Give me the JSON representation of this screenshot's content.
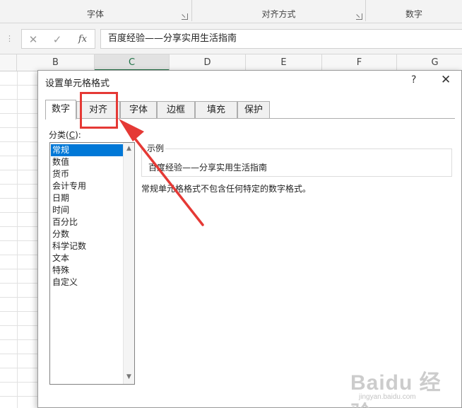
{
  "ribbon": {
    "groups": [
      {
        "label": "字体"
      },
      {
        "label": "对齐方式"
      },
      {
        "label": "数字"
      }
    ]
  },
  "formula_bar": {
    "grip": "⋮",
    "cancel": "✕",
    "enter": "✓",
    "fx": "fx",
    "content": "百度经验——分享实用生活指南"
  },
  "columns": [
    "B",
    "C",
    "D",
    "E",
    "F",
    "G"
  ],
  "active_column": "C",
  "dialog": {
    "title": "设置单元格格式",
    "help": "?",
    "close": "✕",
    "tabs": [
      "数字",
      "对齐",
      "字体",
      "边框",
      "填充",
      "保护"
    ],
    "active_tab": "数字",
    "category_label": "分类(",
    "category_hotkey": "C",
    "category_label_end": "):",
    "categories": [
      "常规",
      "数值",
      "货币",
      "会计专用",
      "日期",
      "时间",
      "百分比",
      "分数",
      "科学记数",
      "文本",
      "特殊",
      "自定义"
    ],
    "selected_category": "常规",
    "sample_label": "示例",
    "sample_value": "百度经验——分享实用生活指南",
    "description": "常规单元格格式不包含任何特定的数字格式。"
  },
  "annotation": {
    "color": "#e53935"
  },
  "watermark": {
    "logo": "Baidu 经验",
    "url": "jingyan.baidu.com"
  }
}
